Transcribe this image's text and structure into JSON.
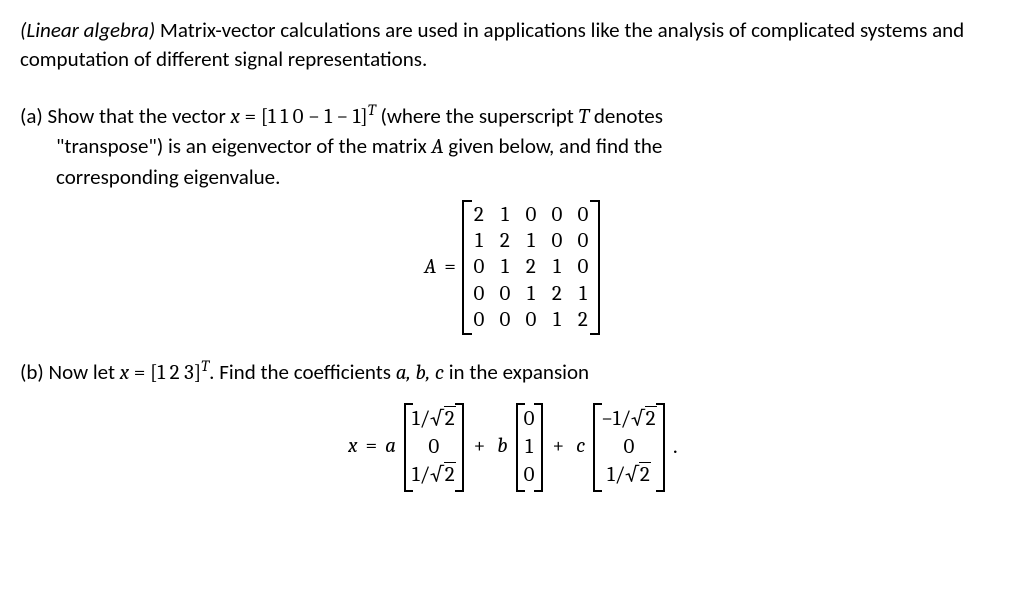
{
  "intro": {
    "subject_label": "(Linear algebra)",
    "text": " Matrix-vector calculations are used in applications like the analysis of complicated systems and computation of different signal representations."
  },
  "part_a": {
    "label": "(a)",
    "line1_pre": " Show that the vector  ",
    "vector_lhs": "x",
    "eq": " = ",
    "vector_entries": "[1  1  0  − 1  − 1]",
    "transpose_sup": "T",
    "line1_post": " (where the superscript ",
    "T_var": "T",
    "line1_post2": " denotes",
    "line2": "\"transpose\") is an eigenvector of the matrix ",
    "A_var": "A",
    "line2_post": " given below, and find the",
    "line3": "corresponding eigenvalue."
  },
  "matrix": {
    "lhs": "A",
    "eq": "=",
    "rows": [
      [
        "2",
        "1",
        "0",
        "0",
        "0"
      ],
      [
        "1",
        "2",
        "1",
        "0",
        "0"
      ],
      [
        "0",
        "1",
        "2",
        "1",
        "0"
      ],
      [
        "0",
        "0",
        "1",
        "2",
        "1"
      ],
      [
        "0",
        "0",
        "0",
        "1",
        "2"
      ]
    ]
  },
  "part_b": {
    "label": "(b)",
    "line1_pre": " Now let ",
    "x_var": "x",
    "eq": " = ",
    "vector_entries": "[1  2  3]",
    "transpose_sup": "T",
    "line1_post": ". Find the coefficients ",
    "abc": "a, b, c",
    "line1_post2": " in the expansion"
  },
  "expansion": {
    "lhs": "x",
    "eq": "=",
    "coef_a": "a",
    "coef_b": "b",
    "coef_c": "c",
    "plus": "+",
    "period": ".",
    "vec1": [
      "1/√2",
      "0",
      "1/√2"
    ],
    "vec2": [
      "0",
      "1",
      "0"
    ],
    "vec3": [
      "−1/√2",
      "0",
      "1/√2"
    ]
  },
  "chart_data": {
    "type": "table",
    "title": "Matrix A (5×5 tridiagonal)",
    "rows": [
      [
        2,
        1,
        0,
        0,
        0
      ],
      [
        1,
        2,
        1,
        0,
        0
      ],
      [
        0,
        1,
        2,
        1,
        0
      ],
      [
        0,
        0,
        1,
        2,
        1
      ],
      [
        0,
        0,
        0,
        1,
        2
      ]
    ],
    "vectors": {
      "x_part_a": [
        1,
        1,
        0,
        -1,
        -1
      ],
      "x_part_b": [
        1,
        2,
        3
      ],
      "basis_vectors": [
        [
          0.7071067811865475,
          0,
          0.7071067811865475
        ],
        [
          0,
          1,
          0
        ],
        [
          -0.7071067811865475,
          0,
          0.7071067811865475
        ]
      ]
    }
  }
}
